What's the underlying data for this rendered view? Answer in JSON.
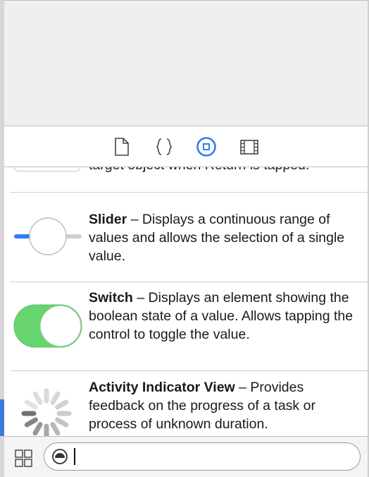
{
  "inspector_tabs": [
    {
      "name": "file-inspector",
      "icon": "file-icon"
    },
    {
      "name": "quick-help",
      "icon": "braces-icon"
    },
    {
      "name": "object-library",
      "icon": "object-library-icon",
      "selected": true
    },
    {
      "name": "media-library",
      "icon": "film-strip-icon"
    }
  ],
  "library": {
    "partial_item": {
      "text": "target object when Return is tapped."
    },
    "items": [
      {
        "title": "Slider",
        "description": " – Displays a continuous range of values and allows the selection of a single value.",
        "icon": "slider-icon"
      },
      {
        "title": "Switch",
        "description": " – Displays an element showing the boolean state of a value. Allows tapping the control to toggle the value.",
        "icon": "switch-icon",
        "state": "on"
      },
      {
        "title": "Activity Indicator View",
        "description": " – Provides feedback on the progress of a task or process of unknown duration.",
        "icon": "activity-indicator-icon"
      }
    ]
  },
  "filter_bar": {
    "view_mode_icon": "grid-view-icon",
    "filter_icon": "object-filter-icon",
    "search_value": ""
  },
  "colors": {
    "accent": "#2f7df6",
    "switch_on": "#67d46f",
    "slider_track": "#2f7df6"
  }
}
